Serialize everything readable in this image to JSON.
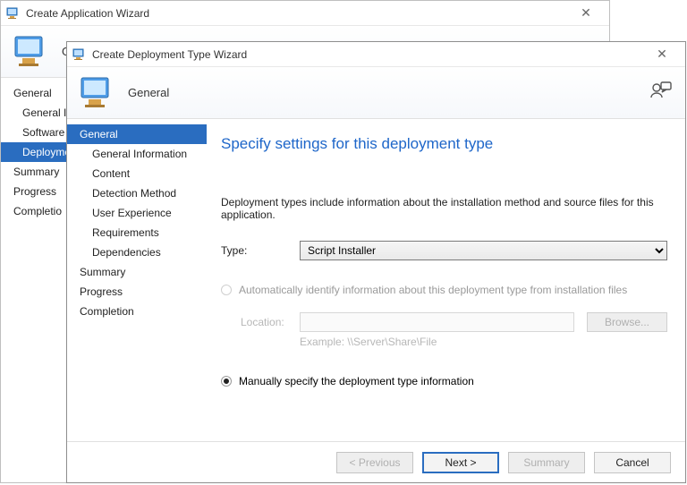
{
  "outer": {
    "title": "Create Application Wizard",
    "banner": "General",
    "nav": {
      "general": "General",
      "general_info": "General Information",
      "software_center": "Software Center",
      "deployment_types": "Deployment Types",
      "summary": "Summary",
      "progress": "Progress",
      "completion": "Completion"
    }
  },
  "inner": {
    "title": "Create Deployment Type Wizard",
    "banner": "General",
    "nav": {
      "general": "General",
      "general_info": "General Information",
      "content": "Content",
      "detection": "Detection Method",
      "ux": "User Experience",
      "requirements": "Requirements",
      "dependencies": "Dependencies",
      "summary": "Summary",
      "progress": "Progress",
      "completion": "Completion"
    },
    "heading": "Specify settings for this deployment type",
    "description": "Deployment types include information about the installation method and source files for this application.",
    "type_label": "Type:",
    "type_value": "Script Installer",
    "radio_auto": "Automatically identify information about this deployment type from installation files",
    "location_label": "Location:",
    "location_value": "",
    "browse": "Browse...",
    "example": "Example: \\\\Server\\Share\\File",
    "radio_manual": "Manually specify the deployment type information",
    "buttons": {
      "previous": "< Previous",
      "next": "Next >",
      "summary": "Summary",
      "cancel": "Cancel"
    }
  }
}
